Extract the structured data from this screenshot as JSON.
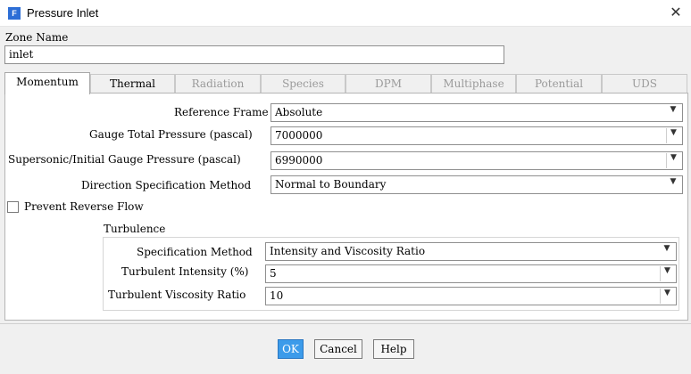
{
  "window": {
    "title": "Pressure Inlet",
    "app_icon": "F"
  },
  "zone": {
    "label": "Zone Name",
    "value": "inlet"
  },
  "tabs": [
    {
      "label": "Momentum",
      "state": "active"
    },
    {
      "label": "Thermal",
      "state": "enabled"
    },
    {
      "label": "Radiation",
      "state": "disabled"
    },
    {
      "label": "Species",
      "state": "disabled"
    },
    {
      "label": "DPM",
      "state": "disabled"
    },
    {
      "label": "Multiphase",
      "state": "disabled"
    },
    {
      "label": "Potential",
      "state": "disabled"
    },
    {
      "label": "UDS",
      "state": "disabled"
    }
  ],
  "momentum": {
    "reference_frame": {
      "label": "Reference Frame",
      "value": "Absolute"
    },
    "gauge_total_pressure": {
      "label": "Gauge Total Pressure (pascal)",
      "value": "7000000"
    },
    "supersonic_pressure": {
      "label": "Supersonic/Initial Gauge Pressure (pascal)",
      "value": "6990000"
    },
    "direction_spec": {
      "label": "Direction Specification Method",
      "value": "Normal to Boundary"
    },
    "prevent_reverse_flow": {
      "label": "Prevent Reverse Flow",
      "checked": false
    }
  },
  "turbulence": {
    "title": "Turbulence",
    "spec_method": {
      "label": "Specification Method",
      "value": "Intensity and Viscosity Ratio"
    },
    "intensity": {
      "label": "Turbulent Intensity (%)",
      "value": "5"
    },
    "viscosity_ratio": {
      "label": "Turbulent Viscosity Ratio",
      "value": "10"
    }
  },
  "buttons": {
    "ok": "OK",
    "cancel": "Cancel",
    "help": "Help"
  },
  "colors": {
    "accent": "#3c9bea",
    "app_icon_bg": "#2d6ed6"
  }
}
